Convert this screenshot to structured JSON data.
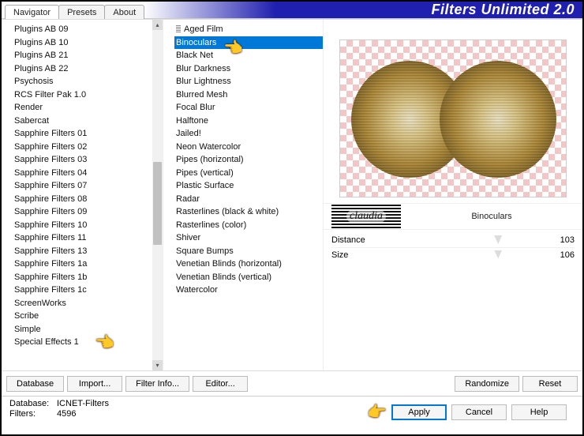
{
  "title": "Filters Unlimited 2.0",
  "tabs": {
    "navigator": "Navigator",
    "presets": "Presets",
    "about": "About"
  },
  "plugin_list": [
    "Plugins AB 09",
    "Plugins AB 10",
    "Plugins AB 21",
    "Plugins AB 22",
    "Psychosis",
    "RCS Filter Pak 1.0",
    "Render",
    "Sabercat",
    "Sapphire Filters 01",
    "Sapphire Filters 02",
    "Sapphire Filters 03",
    "Sapphire Filters 04",
    "Sapphire Filters 07",
    "Sapphire Filters 08",
    "Sapphire Filters 09",
    "Sapphire Filters 10",
    "Sapphire Filters 11",
    "Sapphire Filters 13",
    "Sapphire Filters 1a",
    "Sapphire Filters 1b",
    "Sapphire Filters 1c",
    "ScreenWorks",
    "Scribe",
    "Simple",
    "Special Effects 1"
  ],
  "filter_list": [
    "Aged Film",
    "Binoculars",
    "Black Net",
    "Blur Darkness",
    "Blur Lightness",
    "Blurred Mesh",
    "Focal Blur",
    "Halftone",
    "Jailed!",
    "Neon Watercolor",
    "Pipes (horizontal)",
    "Pipes (vertical)",
    "Plastic Surface",
    "Radar",
    "Rasterlines (black & white)",
    "Rasterlines (color)",
    "Shiver",
    "Square Bumps",
    "Venetian Blinds (horizontal)",
    "Venetian Blinds (vertical)",
    "Watercolor"
  ],
  "selected_filter_index": 1,
  "logo_text": "claudia",
  "selected_filter_name": "Binoculars",
  "params": [
    {
      "label": "Distance",
      "value": "103"
    },
    {
      "label": "Size",
      "value": "106"
    }
  ],
  "buttons": {
    "database": "Database",
    "import": "Import...",
    "filter_info": "Filter Info...",
    "editor": "Editor...",
    "randomize": "Randomize",
    "reset": "Reset",
    "apply": "Apply",
    "cancel": "Cancel",
    "help": "Help"
  },
  "status": {
    "db_label": "Database:",
    "db_value": "ICNET-Filters",
    "filters_label": "Filters:",
    "filters_value": "4596"
  }
}
